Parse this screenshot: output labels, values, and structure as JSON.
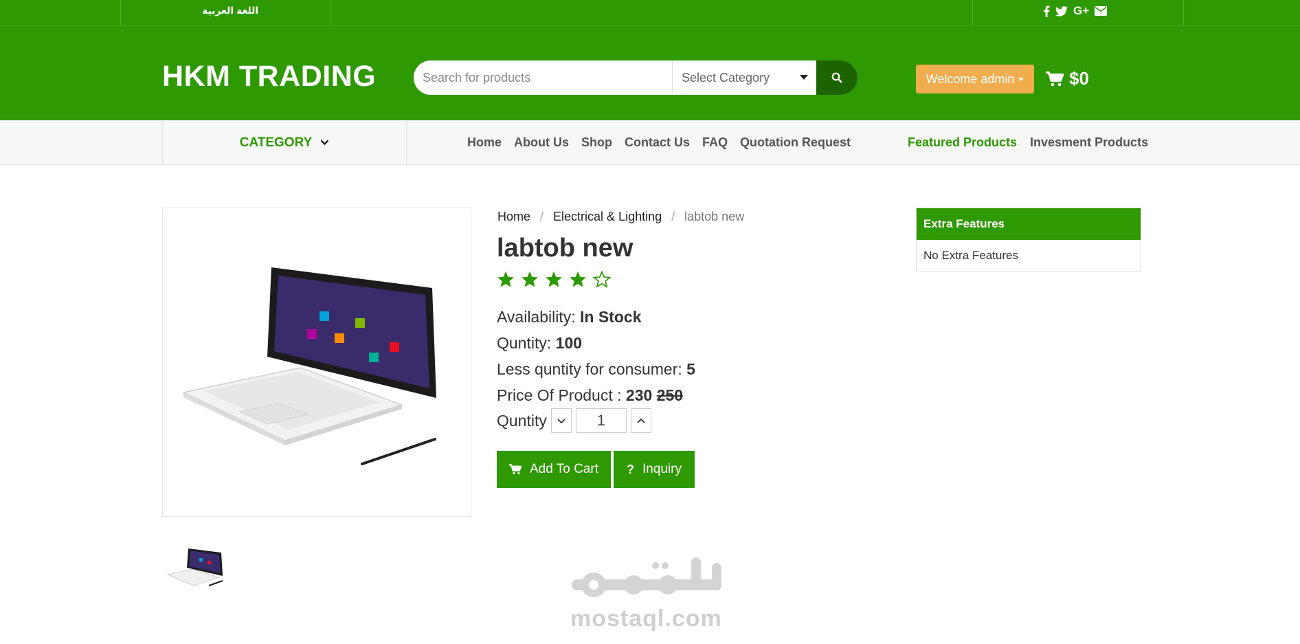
{
  "topbar": {
    "language_label": "اللغة العربية",
    "social_icons": [
      "facebook-icon",
      "twitter-icon",
      "google-plus-icon",
      "envelope-icon"
    ]
  },
  "header": {
    "logo": "HKM TRADING",
    "search_placeholder": "Search for products",
    "category_select": "Select Category",
    "welcome_label": "Welcome admin",
    "cart_total": "$0"
  },
  "nav": {
    "category_label": "CATEGORY",
    "links": [
      "Home",
      "About Us",
      "Shop",
      "Contact Us",
      "FAQ",
      "Quotation Request"
    ],
    "right_links": [
      "Featured Products",
      "Invesment Products"
    ]
  },
  "breadcrumb": {
    "items": [
      "Home",
      "Electrical & Lighting",
      "labtob new"
    ]
  },
  "product": {
    "title": "labtob new",
    "rating": 4,
    "rating_max": 5,
    "availability_label": "Availability:",
    "availability_value": "In Stock",
    "quantity_label": "Quntity:",
    "quantity_value": "100",
    "less_qty_label": "Less quntity for consumer:",
    "less_qty_value": "5",
    "price_label": "Price Of Product :",
    "price": "230",
    "old_price": "250",
    "qty_selector_label": "Quntity",
    "qty_selected": "1",
    "add_to_cart": "Add To Cart",
    "inquiry": "Inquiry"
  },
  "extra_features": {
    "title": "Extra Features",
    "body": "No Extra Features"
  },
  "watermark": {
    "url": "mostaql.com"
  },
  "colors": {
    "brand_green": "#2e9900",
    "dark_green": "#1d6300",
    "welcome_orange": "#f0ad4e"
  }
}
